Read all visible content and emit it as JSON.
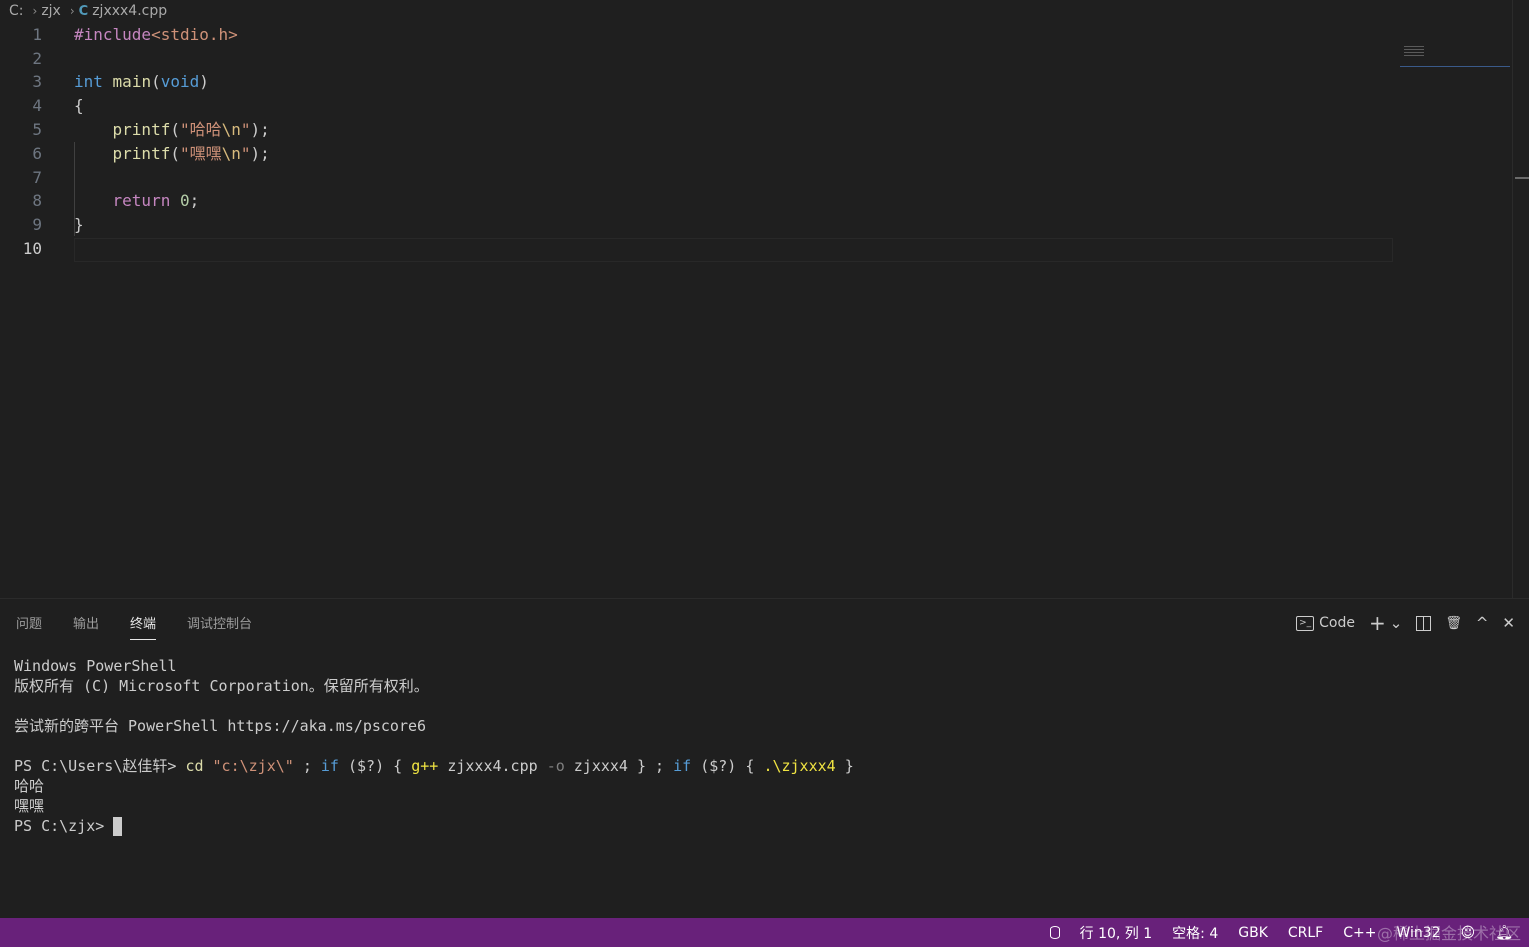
{
  "breadcrumb": {
    "drive": "C:",
    "folder": "zjx",
    "file": "zjxxx4.cpp",
    "file_icon": "C"
  },
  "editor": {
    "line_numbers": [
      "1",
      "2",
      "3",
      "4",
      "5",
      "6",
      "7",
      "8",
      "9",
      "10"
    ],
    "active_line": "10",
    "code": {
      "l1_directive": "#include",
      "l1_header": "<stdio.h>",
      "l3_type": "int",
      "l3_func": "main",
      "l3_open": "(",
      "l3_param": "void",
      "l3_close": ")",
      "l4": "{",
      "l5_func": "printf",
      "l5_str": "\"哈哈",
      "l5_esc": "\\n",
      "l5_end": "\"",
      "l6_func": "printf",
      "l6_str": "\"嘿嘿",
      "l6_esc": "\\n",
      "l6_end": "\"",
      "l8_kw": "return",
      "l8_num": "0",
      "l9": "}"
    }
  },
  "panel": {
    "tabs": [
      "问题",
      "输出",
      "终端",
      "调试控制台"
    ],
    "active_tab": "终端",
    "actions": {
      "profile_label": "Code",
      "add": "+",
      "dropdown": "⌄",
      "trash": "🗑",
      "maximize": "^",
      "close": "✕"
    }
  },
  "terminal": {
    "l1": "Windows PowerShell",
    "l2": "版权所有 (C) Microsoft Corporation。保留所有权利。",
    "l4": "尝试新的跨平台 PowerShell https://aka.ms/pscore6",
    "prompt1": "PS C:\\Users\\赵佳轩> ",
    "cmd_cd": "cd",
    "cmd_path": "\"c:\\zjx\\\"",
    "cmd_sep1": " ; ",
    "cmd_if1": "if",
    "cmd_cond1": " ($?) { ",
    "cmd_gpp": "g++",
    "cmd_src": " zjxxx4.cpp ",
    "cmd_o": "-o",
    "cmd_out": " zjxxx4 } ; ",
    "cmd_if2": "if",
    "cmd_cond2": " ($?) { ",
    "cmd_run": ".\\zjxxx4",
    "cmd_end": " }",
    "out1": "哈哈",
    "out2": "嘿嘿",
    "prompt2": "PS C:\\zjx> "
  },
  "status_bar": {
    "position": "行 10, 列 1",
    "spaces": "空格: 4",
    "encoding": "GBK",
    "eol": "CRLF",
    "language": "C++",
    "platform": "Win32",
    "watermark": "@稀土掘金技术社区"
  },
  "colors": {
    "status_bar": "#68217a",
    "editor_bg": "#1f1f1f"
  }
}
